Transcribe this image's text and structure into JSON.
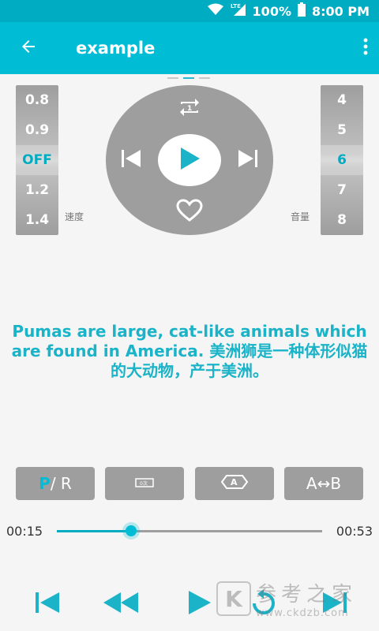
{
  "status_bar": {
    "battery": "100%",
    "time": "8:00 PM",
    "network": "LTE"
  },
  "app_bar": {
    "title": "example"
  },
  "speed_picker": {
    "items": [
      "0.8",
      "0.9",
      "OFF",
      "1.2",
      "1.4"
    ],
    "selected": "OFF",
    "label": "速度"
  },
  "volume_picker": {
    "items": [
      "4",
      "5",
      "6",
      "7",
      "8"
    ],
    "selected": "6",
    "label": "音量"
  },
  "repeat_badge": "1",
  "subtitle": {
    "english": "Pumas are large, cat-like animals which are found in America.",
    "chinese": "美洲狮是一种体形似猫的大动物，产于美洲。"
  },
  "mode_buttons": {
    "pr_p": "P",
    "pr_rest": " / R",
    "ab": "A↔B",
    "repeat_count": "0次",
    "a_label": "A"
  },
  "progress": {
    "current": "00:15",
    "total": "00:53",
    "fraction": 0.28
  },
  "watermark": {
    "cn": "参考之家",
    "url": "www.ckdzb.com",
    "logo": "K"
  },
  "colors": {
    "accent": "#00bcd4",
    "statusbar": "#00acc1",
    "control_gray": "#9e9e9e"
  }
}
